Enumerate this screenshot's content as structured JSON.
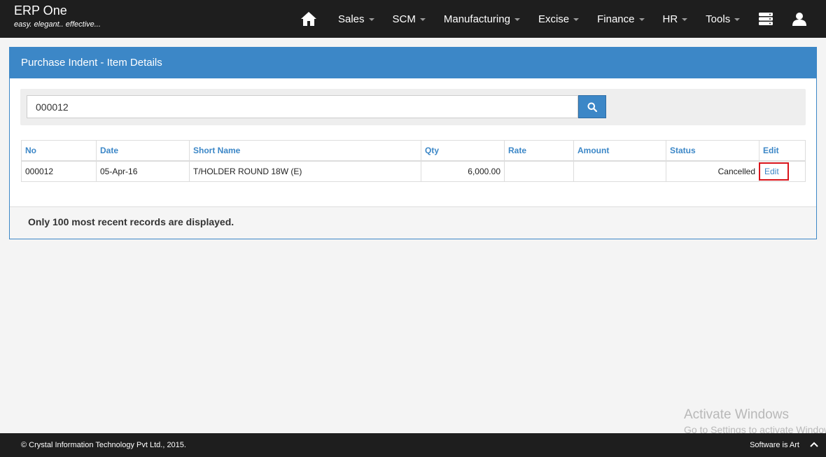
{
  "brand": {
    "title": "ERP One",
    "tagline": "easy. elegant.. effective..."
  },
  "nav": {
    "home_icon": "home-icon",
    "items": [
      {
        "label": "Sales"
      },
      {
        "label": "SCM"
      },
      {
        "label": "Manufacturing"
      },
      {
        "label": "Excise"
      },
      {
        "label": "Finance"
      },
      {
        "label": "HR"
      },
      {
        "label": "Tools"
      }
    ],
    "right_icons": [
      "server-icon",
      "user-icon"
    ]
  },
  "panel": {
    "title": "Purchase Indent - Item Details",
    "search": {
      "value": "000012",
      "placeholder": "",
      "button_icon": "search-icon"
    },
    "table": {
      "headers": [
        "No",
        "Date",
        "Short Name",
        "Qty",
        "Rate",
        "Amount",
        "Status",
        "Edit"
      ],
      "rows": [
        {
          "no": "000012",
          "date": "05-Apr-16",
          "short_name": "T/HOLDER ROUND 18W (E)",
          "qty": "6,000.00",
          "rate": "",
          "amount": "",
          "status": "Cancelled",
          "edit": "Edit"
        }
      ]
    },
    "footer_note": "Only 100 most recent records are displayed."
  },
  "watermark": {
    "line1": "Activate Windows",
    "line2": "Go to Settings to activate Windows."
  },
  "footer": {
    "copyright": "© Crystal Information Technology Pvt Ltd., 2015.",
    "right_text": "Software is Art"
  },
  "colors": {
    "navbar": "#1e1e1e",
    "accent": "#3c87c7",
    "highlight": "#d9141b"
  }
}
